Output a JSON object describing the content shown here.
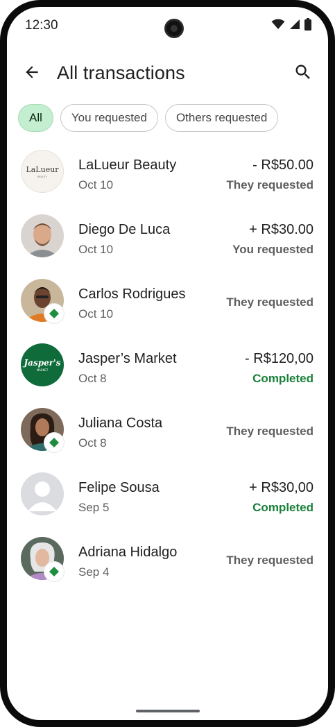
{
  "status_bar": {
    "time": "12:30"
  },
  "app_bar": {
    "title": "All transactions"
  },
  "chips": [
    {
      "label": "All",
      "selected": true
    },
    {
      "label": "You requested",
      "selected": false
    },
    {
      "label": "Others requested",
      "selected": false
    }
  ],
  "transactions": [
    {
      "name": "LaLueur Beauty",
      "date": "Oct 10",
      "amount": "- R$50.00",
      "status": "They requested",
      "avatar_logo": "LaLueur",
      "avatar_logo_sub": "BEAUTY"
    },
    {
      "name": "Diego De Luca",
      "date": "Oct 10",
      "amount": "+ R$30.00",
      "status": "You requested"
    },
    {
      "name": "Carlos Rodrigues",
      "date": "Oct 10",
      "amount": "",
      "status": "They requested"
    },
    {
      "name": "Jasper’s Market",
      "date": "Oct 8",
      "amount": "- R$120,00",
      "status": "Completed",
      "avatar_logo": "Jasper's",
      "avatar_logo_sub": "MARKET"
    },
    {
      "name": "Juliana Costa",
      "date": "Oct 8",
      "amount": "",
      "status": "They requested"
    },
    {
      "name": "Felipe Sousa",
      "date": "Sep 5",
      "amount": "+ R$30,00",
      "status": "Completed"
    },
    {
      "name": "Adriana Hidalgo",
      "date": "Sep 4",
      "amount": "",
      "status": "They requested"
    }
  ],
  "colors": {
    "chip_selected_bg": "#c4eed0",
    "completed_green": "#188038",
    "badge_green": "#1e8e3e",
    "jasper_green": "#0f6b3a"
  },
  "icons": {
    "back": "arrow-left-icon",
    "search": "search-icon",
    "wifi": "wifi-icon",
    "signal": "signal-icon",
    "battery": "battery-icon",
    "badge": "google-pay-badge-icon"
  }
}
